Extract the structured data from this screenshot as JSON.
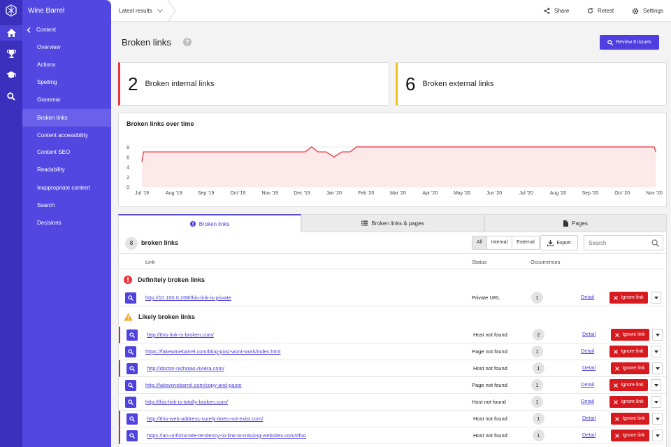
{
  "sidebar": {
    "brand": "Wine Barrel",
    "back_label": "Content",
    "items": [
      {
        "label": "Overview"
      },
      {
        "label": "Actions"
      },
      {
        "label": "Spelling"
      },
      {
        "label": "Grammar"
      },
      {
        "label": "Broken links"
      },
      {
        "label": "Content accessibility"
      },
      {
        "label": "Content SEO"
      },
      {
        "label": "Readability"
      },
      {
        "label": "Inappropriate content"
      },
      {
        "label": "Search"
      },
      {
        "label": "Decisions"
      }
    ]
  },
  "topbar": {
    "breadcrumb": "Latest results",
    "share": "Share",
    "retest": "Retest",
    "settings": "Settings"
  },
  "header": {
    "title": "Broken links",
    "review_button": "Review 8 issues"
  },
  "summary": {
    "internal": {
      "count": "2",
      "label": "Broken internal links",
      "color": "#e8333a"
    },
    "external": {
      "count": "6",
      "label": "Broken external links",
      "color": "#f2c21b"
    }
  },
  "chart_data": {
    "type": "line",
    "title": "Broken links over time",
    "xlabel": "",
    "ylabel": "",
    "ylim": [
      0,
      8
    ],
    "yticks": [
      0,
      2,
      4,
      6,
      8
    ],
    "categories": [
      "Jul '19",
      "Aug '19",
      "Sep '19",
      "Oct '19",
      "Nov '19",
      "Dec '19",
      "Jan '20",
      "Feb '20",
      "Mar '20",
      "Apr '20",
      "May '20",
      "Jun '20",
      "Jul '20",
      "Aug '20",
      "Sep '20",
      "Oct '20",
      "Nov '20"
    ],
    "series": [
      {
        "name": "",
        "color": "#e8333a",
        "points": [
          {
            "x": 0.0,
            "y": 5
          },
          {
            "x": 0.05,
            "y": 7
          },
          {
            "x": 5.1,
            "y": 7
          },
          {
            "x": 5.3,
            "y": 8
          },
          {
            "x": 5.5,
            "y": 7
          },
          {
            "x": 5.75,
            "y": 7
          },
          {
            "x": 6.0,
            "y": 6
          },
          {
            "x": 6.25,
            "y": 7
          },
          {
            "x": 6.5,
            "y": 7
          },
          {
            "x": 6.7,
            "y": 8
          },
          {
            "x": 16.0,
            "y": 8
          },
          {
            "x": 16.05,
            "y": 7
          }
        ]
      }
    ],
    "grid": true,
    "fill": "#fde9e9"
  },
  "tabs": [
    {
      "label": "Broken links"
    },
    {
      "label": "Broken links & pages"
    },
    {
      "label": "Pages"
    }
  ],
  "table": {
    "count": "8",
    "count_label": "broken links",
    "filters": [
      "All",
      "Internal",
      "External"
    ],
    "export": "Export",
    "search_placeholder": "Search",
    "columns": {
      "link": "Link",
      "status": "Status",
      "occurrences": "Occurrences"
    },
    "detail_label": "Detail",
    "ignore_label": "Ignore link",
    "groups": [
      {
        "title": "Definitely broken links",
        "rows": [
          {
            "url": "http://10.100.0.208/this-link-is-private",
            "status": "Private URL",
            "occurrences": "1",
            "flag": false
          }
        ]
      },
      {
        "title": "Likely broken links",
        "rows": [
          {
            "url": "http://this-link-is-broken.com/",
            "status": "Host not found",
            "occurrences": "2",
            "flag": true
          },
          {
            "url": "https://fakewinebarrel.com/blog-post-wont-work/index.html",
            "status": "Page not found",
            "occurrences": "1",
            "flag": false
          },
          {
            "url": "http://doctor-nicholas-riviera.com/",
            "status": "Host not found",
            "occurrences": "1",
            "flag": true
          },
          {
            "url": "http://fakewinebarrel.com/copy-and-paste",
            "status": "Page not found",
            "occurrences": "1",
            "flag": false
          },
          {
            "url": "http://this-link-is-totally-broken.com/",
            "status": "Host not found",
            "occurrences": "1",
            "flag": false
          },
          {
            "url": "http://this-web-address-surely-does-not-exist.com/",
            "status": "Host not found",
            "occurrences": "1",
            "flag": true
          },
          {
            "url": "https://an-unfortunate-tendency-to-link-to-missing-websites.com/#foo",
            "status": "Host not found",
            "occurrences": "1",
            "flag": true
          }
        ]
      }
    ]
  }
}
